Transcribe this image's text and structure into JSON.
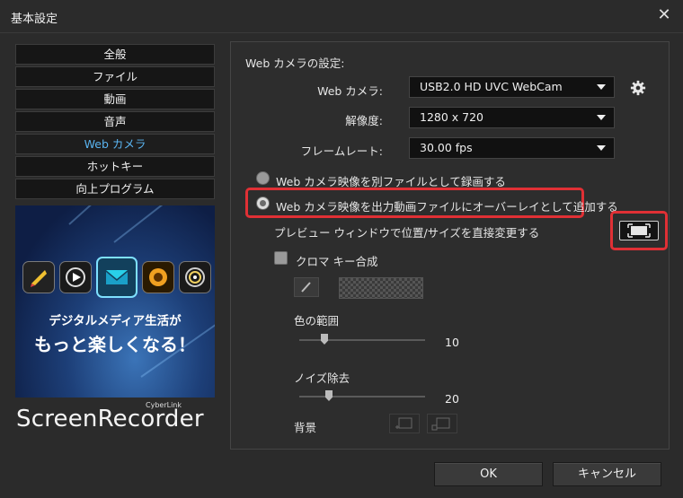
{
  "window": {
    "title": "基本設定",
    "close_glyph": "✕"
  },
  "nav": {
    "items": [
      {
        "label": "全般",
        "active": false
      },
      {
        "label": "ファイル",
        "active": false
      },
      {
        "label": "動画",
        "active": false
      },
      {
        "label": "音声",
        "active": false
      },
      {
        "label": "Web カメラ",
        "active": true
      },
      {
        "label": "ホットキー",
        "active": false
      },
      {
        "label": "向上プログラム",
        "active": false
      }
    ]
  },
  "promo": {
    "line1": "デジタルメディア生活が",
    "line2": "もっと楽しくなる！",
    "icons": [
      "director-icon",
      "power-dvd-icon",
      "screen-recorder-icon",
      "photo-director-icon",
      "power-dvd-disc-icon"
    ]
  },
  "brand": {
    "small": "CyberLink",
    "name": "ScreenRecorder"
  },
  "settings": {
    "section_title": "Web カメラの設定:",
    "webcam": {
      "label": "Web カメラ:",
      "value": "USB2.0 HD UVC WebCam"
    },
    "resolution": {
      "label": "解像度:",
      "value": "1280 x 720"
    },
    "framerate": {
      "label": "フレームレート:",
      "value": "30.00 fps"
    },
    "radio_separate": {
      "label": "Web カメラ映像を別ファイルとして録画する",
      "checked": false
    },
    "radio_overlay": {
      "label": "Web カメラ映像を出力動画ファイルにオーバーレイとして追加する",
      "checked": true
    },
    "preview_hint": "プレビュー ウィンドウで位置/サイズを直接変更する",
    "chroma": {
      "label": "クロマ キー合成",
      "checked": false,
      "color_range": {
        "label": "色の範囲",
        "value": "10",
        "level": 0.18
      },
      "noise": {
        "label": "ノイズ除去",
        "value": "20",
        "level": 0.22
      },
      "background_label": "背景"
    }
  },
  "footer": {
    "ok": "OK",
    "cancel": "キャンセル"
  },
  "colors": {
    "accent": "#5ab4f0",
    "highlight": "#e03035"
  }
}
